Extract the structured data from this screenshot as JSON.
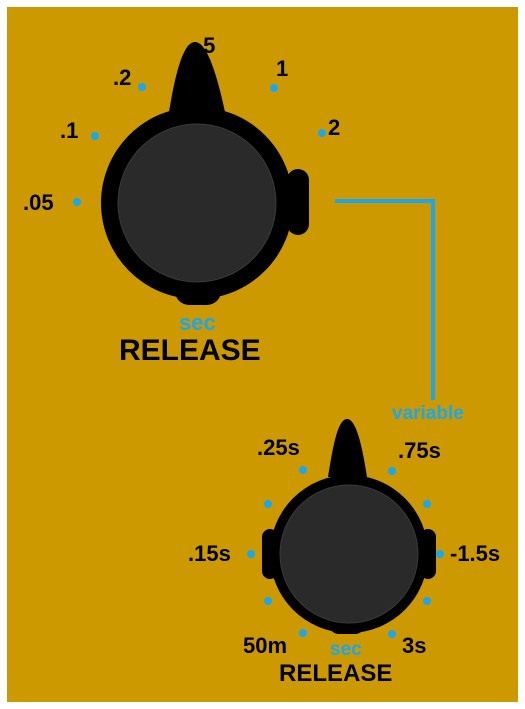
{
  "panel_color": "#CC9900",
  "accent_color": "#1AA7EE",
  "knob_color": "#000000",
  "knob_face_color": "#2A2A2A",
  "release_knob_1": {
    "title": "RELEASE",
    "unit": "sec",
    "scale_labels": [
      ".05",
      ".1",
      ".2",
      ".5",
      "1",
      "2"
    ]
  },
  "release_knob_2": {
    "title": "RELEASE",
    "unit": "sec",
    "scale_labels": [
      "50m",
      ".15s",
      ".25s",
      ".75s",
      "-1.5s",
      "3s"
    ]
  },
  "switch_link": {
    "label": "variable"
  }
}
